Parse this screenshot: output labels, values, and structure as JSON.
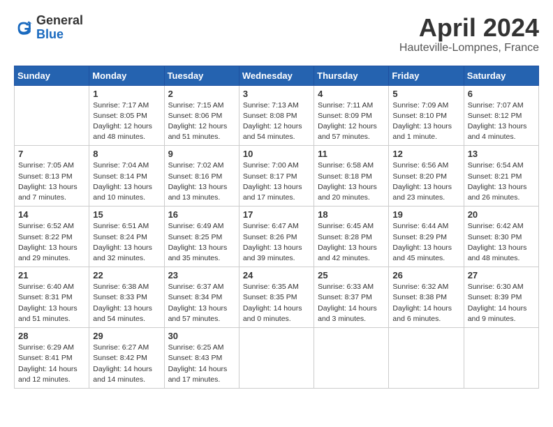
{
  "logo": {
    "text_general": "General",
    "text_blue": "Blue"
  },
  "title": "April 2024",
  "location": "Hauteville-Lompnes, France",
  "days_of_week": [
    "Sunday",
    "Monday",
    "Tuesday",
    "Wednesday",
    "Thursday",
    "Friday",
    "Saturday"
  ],
  "weeks": [
    [
      {
        "day": "",
        "info": ""
      },
      {
        "day": "1",
        "info": "Sunrise: 7:17 AM\nSunset: 8:05 PM\nDaylight: 12 hours\nand 48 minutes."
      },
      {
        "day": "2",
        "info": "Sunrise: 7:15 AM\nSunset: 8:06 PM\nDaylight: 12 hours\nand 51 minutes."
      },
      {
        "day": "3",
        "info": "Sunrise: 7:13 AM\nSunset: 8:08 PM\nDaylight: 12 hours\nand 54 minutes."
      },
      {
        "day": "4",
        "info": "Sunrise: 7:11 AM\nSunset: 8:09 PM\nDaylight: 12 hours\nand 57 minutes."
      },
      {
        "day": "5",
        "info": "Sunrise: 7:09 AM\nSunset: 8:10 PM\nDaylight: 13 hours\nand 1 minute."
      },
      {
        "day": "6",
        "info": "Sunrise: 7:07 AM\nSunset: 8:12 PM\nDaylight: 13 hours\nand 4 minutes."
      }
    ],
    [
      {
        "day": "7",
        "info": "Sunrise: 7:05 AM\nSunset: 8:13 PM\nDaylight: 13 hours\nand 7 minutes."
      },
      {
        "day": "8",
        "info": "Sunrise: 7:04 AM\nSunset: 8:14 PM\nDaylight: 13 hours\nand 10 minutes."
      },
      {
        "day": "9",
        "info": "Sunrise: 7:02 AM\nSunset: 8:16 PM\nDaylight: 13 hours\nand 13 minutes."
      },
      {
        "day": "10",
        "info": "Sunrise: 7:00 AM\nSunset: 8:17 PM\nDaylight: 13 hours\nand 17 minutes."
      },
      {
        "day": "11",
        "info": "Sunrise: 6:58 AM\nSunset: 8:18 PM\nDaylight: 13 hours\nand 20 minutes."
      },
      {
        "day": "12",
        "info": "Sunrise: 6:56 AM\nSunset: 8:20 PM\nDaylight: 13 hours\nand 23 minutes."
      },
      {
        "day": "13",
        "info": "Sunrise: 6:54 AM\nSunset: 8:21 PM\nDaylight: 13 hours\nand 26 minutes."
      }
    ],
    [
      {
        "day": "14",
        "info": "Sunrise: 6:52 AM\nSunset: 8:22 PM\nDaylight: 13 hours\nand 29 minutes."
      },
      {
        "day": "15",
        "info": "Sunrise: 6:51 AM\nSunset: 8:24 PM\nDaylight: 13 hours\nand 32 minutes."
      },
      {
        "day": "16",
        "info": "Sunrise: 6:49 AM\nSunset: 8:25 PM\nDaylight: 13 hours\nand 35 minutes."
      },
      {
        "day": "17",
        "info": "Sunrise: 6:47 AM\nSunset: 8:26 PM\nDaylight: 13 hours\nand 39 minutes."
      },
      {
        "day": "18",
        "info": "Sunrise: 6:45 AM\nSunset: 8:28 PM\nDaylight: 13 hours\nand 42 minutes."
      },
      {
        "day": "19",
        "info": "Sunrise: 6:44 AM\nSunset: 8:29 PM\nDaylight: 13 hours\nand 45 minutes."
      },
      {
        "day": "20",
        "info": "Sunrise: 6:42 AM\nSunset: 8:30 PM\nDaylight: 13 hours\nand 48 minutes."
      }
    ],
    [
      {
        "day": "21",
        "info": "Sunrise: 6:40 AM\nSunset: 8:31 PM\nDaylight: 13 hours\nand 51 minutes."
      },
      {
        "day": "22",
        "info": "Sunrise: 6:38 AM\nSunset: 8:33 PM\nDaylight: 13 hours\nand 54 minutes."
      },
      {
        "day": "23",
        "info": "Sunrise: 6:37 AM\nSunset: 8:34 PM\nDaylight: 13 hours\nand 57 minutes."
      },
      {
        "day": "24",
        "info": "Sunrise: 6:35 AM\nSunset: 8:35 PM\nDaylight: 14 hours\nand 0 minutes."
      },
      {
        "day": "25",
        "info": "Sunrise: 6:33 AM\nSunset: 8:37 PM\nDaylight: 14 hours\nand 3 minutes."
      },
      {
        "day": "26",
        "info": "Sunrise: 6:32 AM\nSunset: 8:38 PM\nDaylight: 14 hours\nand 6 minutes."
      },
      {
        "day": "27",
        "info": "Sunrise: 6:30 AM\nSunset: 8:39 PM\nDaylight: 14 hours\nand 9 minutes."
      }
    ],
    [
      {
        "day": "28",
        "info": "Sunrise: 6:29 AM\nSunset: 8:41 PM\nDaylight: 14 hours\nand 12 minutes."
      },
      {
        "day": "29",
        "info": "Sunrise: 6:27 AM\nSunset: 8:42 PM\nDaylight: 14 hours\nand 14 minutes."
      },
      {
        "day": "30",
        "info": "Sunrise: 6:25 AM\nSunset: 8:43 PM\nDaylight: 14 hours\nand 17 minutes."
      },
      {
        "day": "",
        "info": ""
      },
      {
        "day": "",
        "info": ""
      },
      {
        "day": "",
        "info": ""
      },
      {
        "day": "",
        "info": ""
      }
    ]
  ]
}
